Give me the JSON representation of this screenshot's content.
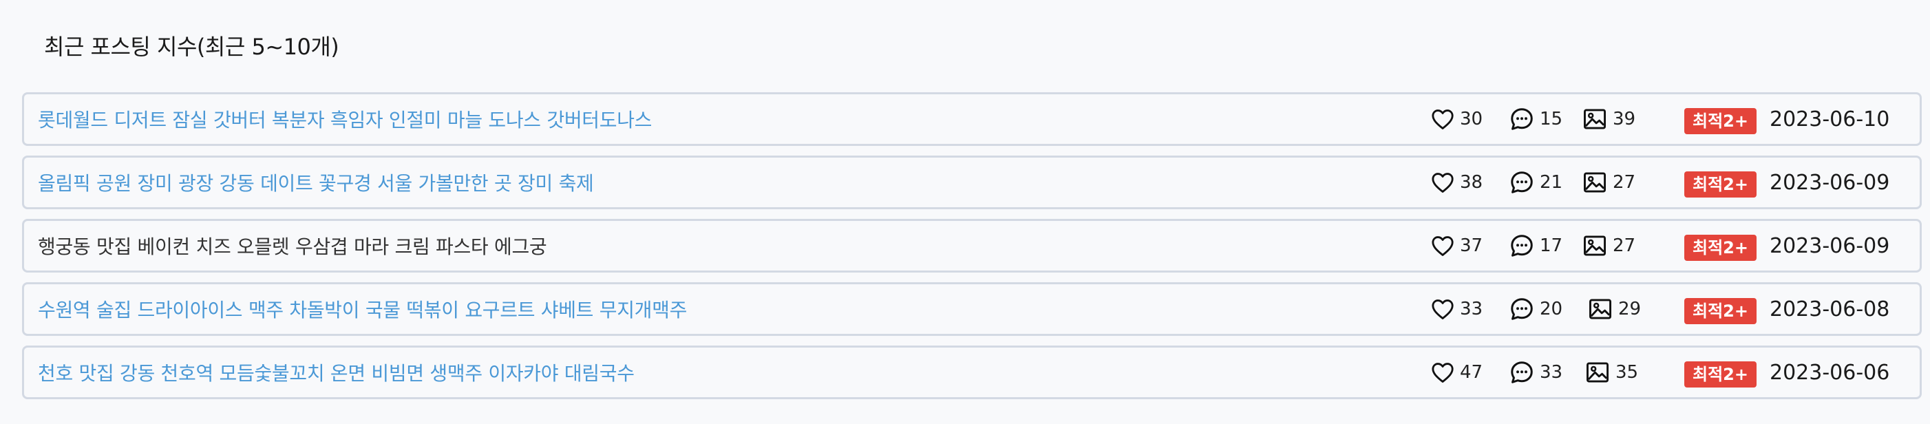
{
  "section": {
    "title": "최근 포스팅 지수(최근 5~10개)"
  },
  "icons": {
    "likes": "heart-icon",
    "comments": "comment-icon",
    "images": "image-icon"
  },
  "colors": {
    "link": "#4a98d6",
    "badge": "#e4443a"
  },
  "posts": [
    {
      "title": "롯데월드 디저트 잠실 갓버터 복분자 흑임자 인절미 마늘 도나스 갓버터도나스",
      "likes": "30",
      "comments": "15",
      "images": "39",
      "badge": "최적2+",
      "date": "2023-06-10"
    },
    {
      "title": "올림픽 공원 장미 광장 강동 데이트 꽃구경 서울 가볼만한 곳 장미 축제",
      "likes": "38",
      "comments": "21",
      "images": "27",
      "badge": "최적2+",
      "date": "2023-06-09"
    },
    {
      "title": "행궁동 맛집 베이컨 치즈 오믈렛 우삼겹 마라 크림 파스타 에그궁",
      "likes": "37",
      "comments": "17",
      "images": "27",
      "badge": "최적2+",
      "date": "2023-06-09"
    },
    {
      "title": "수원역 술집 드라이아이스 맥주 차돌박이 국물 떡볶이 요구르트 샤베트 무지개맥주",
      "likes": "33",
      "comments": "20",
      "images": "29",
      "badge": "최적2+",
      "date": "2023-06-08"
    },
    {
      "title": "천호 맛집 강동 천호역 모듬숯불꼬치 온면 비빔면 생맥주 이자카야 대림국수",
      "likes": "47",
      "comments": "33",
      "images": "35",
      "badge": "최적2+",
      "date": "2023-06-06"
    }
  ]
}
